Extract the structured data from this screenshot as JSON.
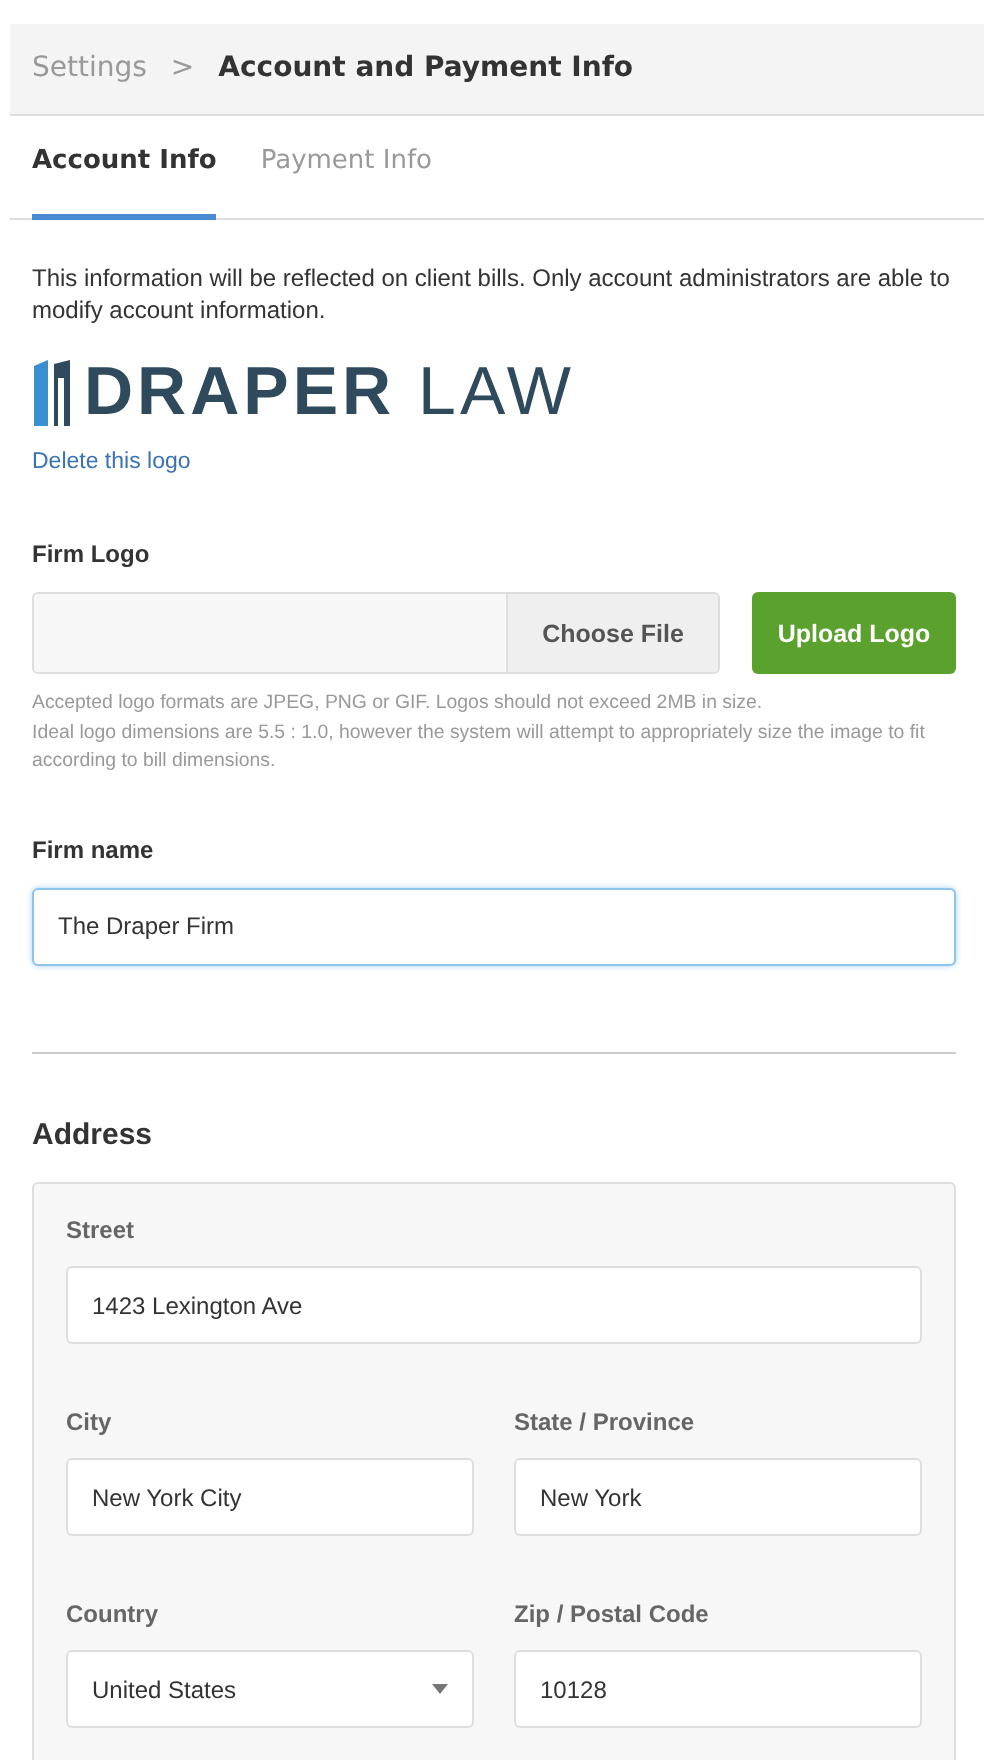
{
  "breadcrumb": [
    {
      "label": "Settings",
      "current": false
    },
    {
      "label": "Account and Payment Info",
      "current": true
    }
  ],
  "breadcrumb_separator": ">",
  "tabs": [
    {
      "label": "Account Info",
      "selected": true
    },
    {
      "label": "Payment Info",
      "selected": false
    }
  ],
  "intro": "This information will be reflected on client bills. Only account administrators are able to modify account information.",
  "logo": {
    "word_1": "DRAPER",
    "word_2": "LAW"
  },
  "delete_logo_link": "Delete this logo",
  "firm_logo": {
    "label": "Firm Logo",
    "choose_button": "Choose File",
    "upload_button": "Upload Logo",
    "help": [
      "Accepted logo formats are JPEG, PNG or GIF. Logos should not exceed 2MB in size.",
      "Ideal logo dimensions are 5.5 : 1.0, however the system will attempt to appropriately size the image to fit according to bill dimensions."
    ]
  },
  "firm_name": {
    "label": "Firm name",
    "value": "The Draper Firm",
    "focused": true
  },
  "address": {
    "title": "Address",
    "rows": [
      [
        {
          "label": "Street",
          "value": "1423 Lexington Ave",
          "kind": "text"
        }
      ],
      [
        {
          "label": "City",
          "value": "New York City",
          "kind": "text"
        },
        {
          "label": "State / Province",
          "value": "New York",
          "kind": "text"
        }
      ],
      [
        {
          "label": "Country",
          "value": "United States",
          "kind": "select"
        },
        {
          "label": "Zip / Postal Code",
          "value": "10128",
          "kind": "text"
        }
      ]
    ]
  }
}
